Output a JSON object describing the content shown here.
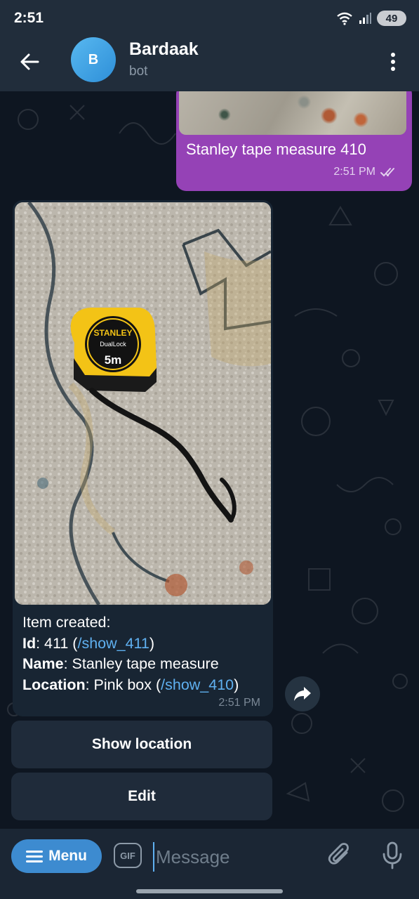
{
  "status_bar": {
    "time": "2:51",
    "battery": "49"
  },
  "header": {
    "title": "Bardaak",
    "subtitle": "bot",
    "avatar_letter": "B"
  },
  "outgoing_message": {
    "text": "Stanley tape measure 410",
    "time": "2:51 PM"
  },
  "incoming_message": {
    "line1": "Item created:",
    "id_label": "Id",
    "id_value": ": 411 (",
    "id_link": "/show_411",
    "id_close": ")",
    "name_label": "Name",
    "name_value": ": Stanley tape measure",
    "location_label": "Location",
    "location_value": ": Pink box (",
    "location_link": "/show_410",
    "location_close": ")",
    "time": "2:51 PM"
  },
  "photo": {
    "brand": "STANLEY",
    "model": "DualLock",
    "size": "5m"
  },
  "keyboard": {
    "buttons": [
      "Show location",
      "Edit"
    ]
  },
  "input": {
    "menu_label": "Menu",
    "gif_label": "GIF",
    "placeholder": "Message"
  },
  "colors": {
    "accent": "#5fb0f0",
    "outgoing_bubble": "#9542b6",
    "incoming_bubble": "#182533",
    "menu_button": "#3d8bd0"
  }
}
